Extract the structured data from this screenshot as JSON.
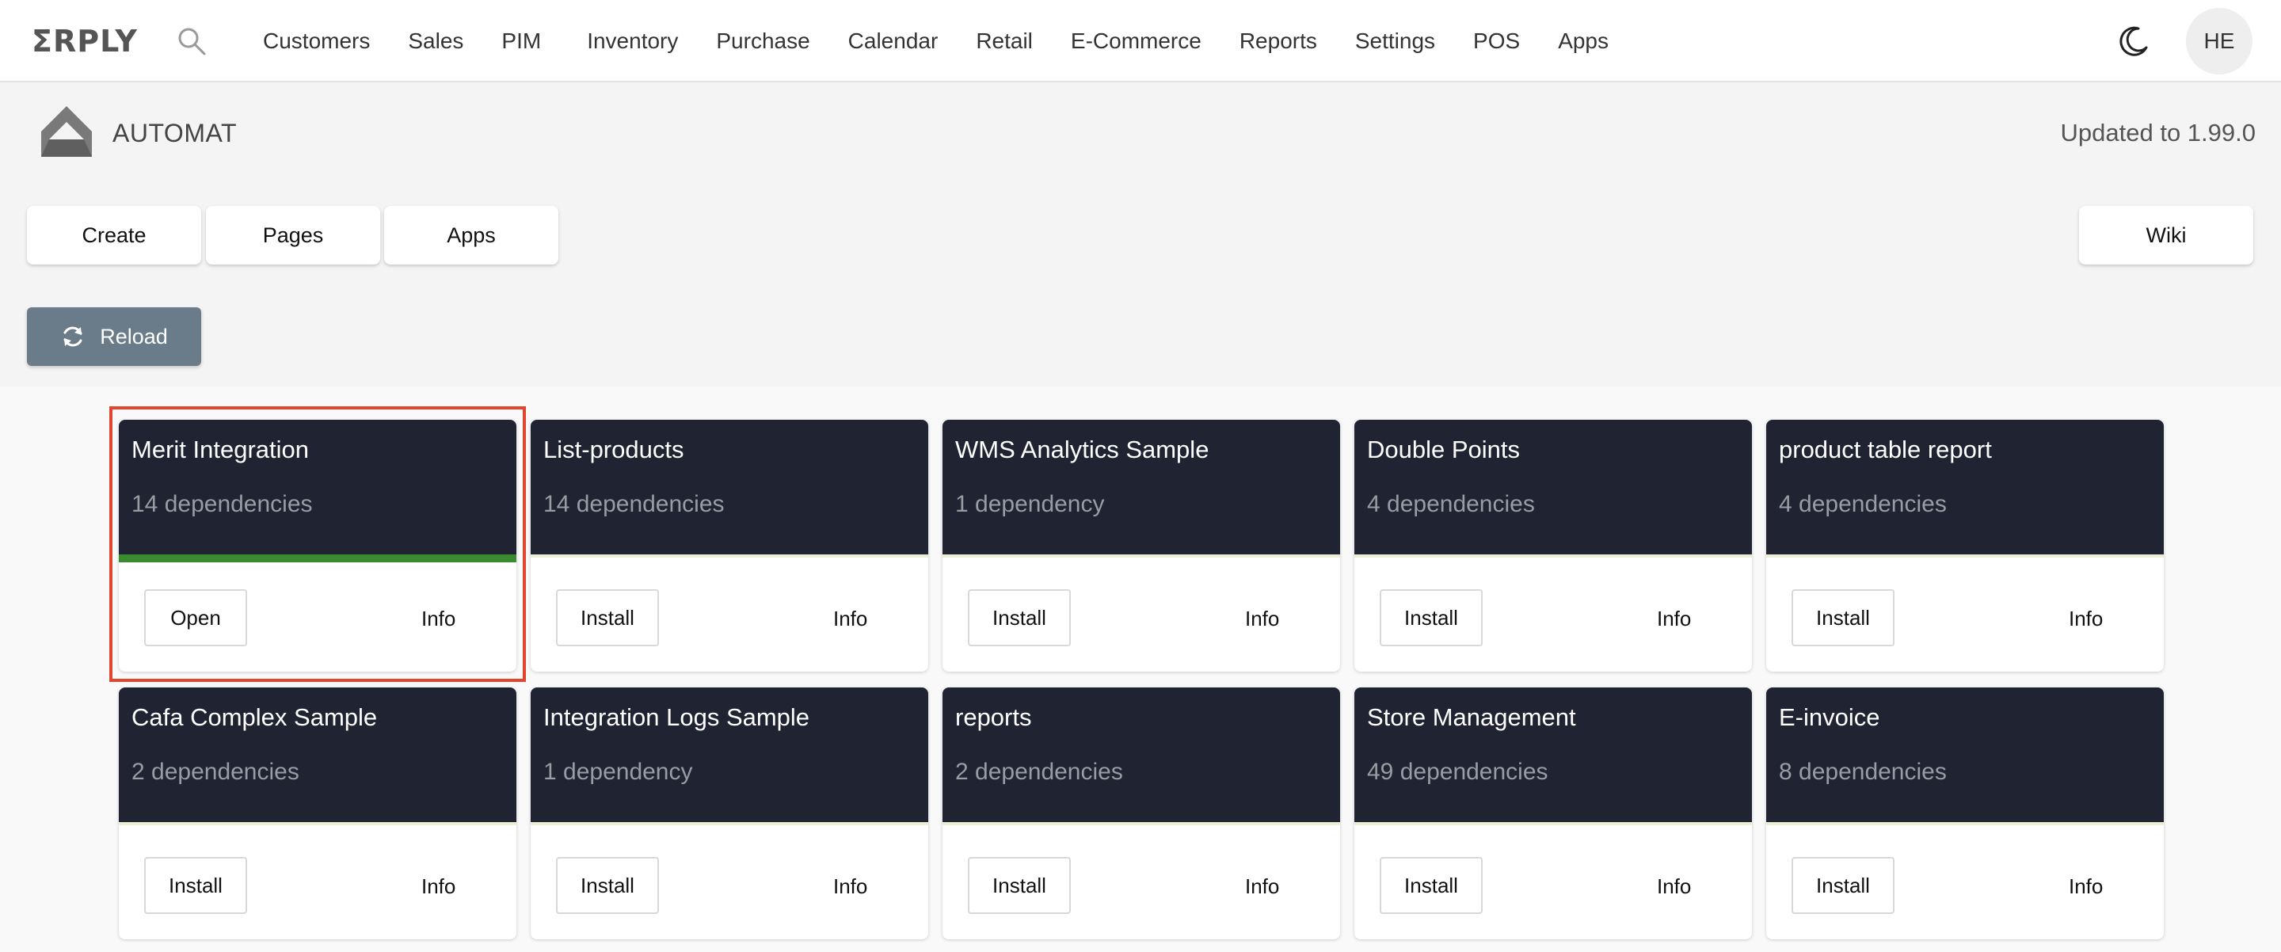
{
  "brand": {
    "logo": "ΣRPLY"
  },
  "nav": [
    "Customers",
    "Sales",
    "PIM",
    "Inventory",
    "Purchase",
    "Calendar",
    "Retail",
    "E-Commerce",
    "Reports",
    "Settings",
    "POS",
    "Apps"
  ],
  "user": {
    "initials": "HE"
  },
  "header": {
    "title": "AUTOMAT",
    "version": "Updated to 1.99.0"
  },
  "toolbar": {
    "create": "Create",
    "pages": "Pages",
    "apps": "Apps",
    "wiki": "Wiki",
    "reload": "Reload"
  },
  "colors": {
    "card_header": "#1f2332",
    "active_bar": "#3a8a2f",
    "reload_bg": "#6a7b89",
    "highlight": "#e0452e"
  },
  "cards": [
    {
      "title": "Merit Integration",
      "deps": "14 dependencies",
      "action": "Open",
      "info": "Info",
      "installed": true
    },
    {
      "title": "List-products",
      "deps": "14 dependencies",
      "action": "Install",
      "info": "Info",
      "installed": false
    },
    {
      "title": "WMS Analytics Sample",
      "deps": "1 dependency",
      "action": "Install",
      "info": "Info",
      "installed": false
    },
    {
      "title": "Double Points",
      "deps": "4 dependencies",
      "action": "Install",
      "info": "Info",
      "installed": false
    },
    {
      "title": "product table report",
      "deps": "4 dependencies",
      "action": "Install",
      "info": "Info",
      "installed": false
    },
    {
      "title": "Cafa Complex Sample",
      "deps": "2 dependencies",
      "action": "Install",
      "info": "Info",
      "installed": false
    },
    {
      "title": "Integration Logs Sample",
      "deps": "1 dependency",
      "action": "Install",
      "info": "Info",
      "installed": false
    },
    {
      "title": "reports",
      "deps": "2 dependencies",
      "action": "Install",
      "info": "Info",
      "installed": false
    },
    {
      "title": "Store Management",
      "deps": "49 dependencies",
      "action": "Install",
      "info": "Info",
      "installed": false
    },
    {
      "title": "E-invoice",
      "deps": "8 dependencies",
      "action": "Install",
      "info": "Info",
      "installed": false
    }
  ]
}
